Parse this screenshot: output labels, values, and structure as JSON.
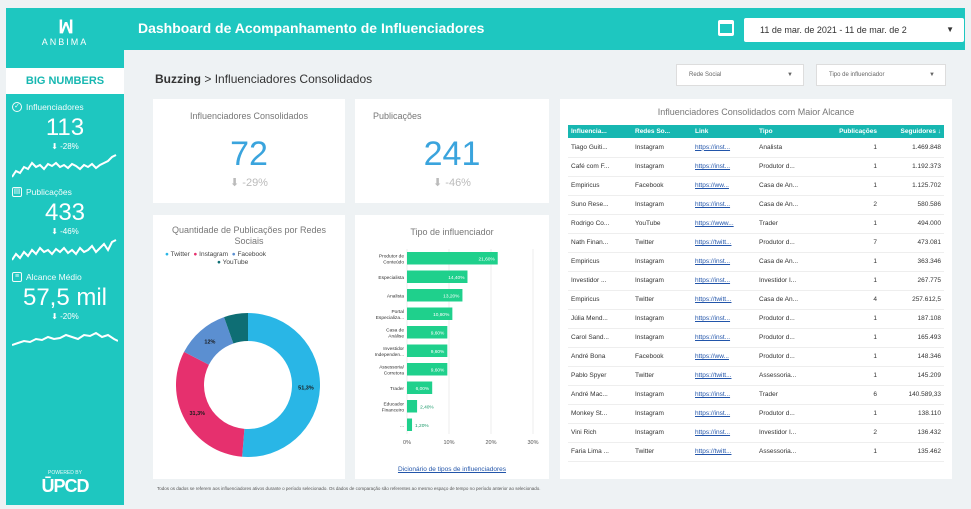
{
  "logo": {
    "mark": "ꟽ",
    "name": "ANBIMA"
  },
  "sidebar": {
    "section_title": "BIG NUMBERS",
    "metrics": [
      {
        "label": "Influenciadores",
        "value": "113",
        "delta": "⬇ -28%"
      },
      {
        "label": "Publicações",
        "value": "433",
        "delta": "⬇ -46%"
      },
      {
        "label": "Alcance Médio",
        "value": "57,5 mil",
        "delta": "⬇ -20%"
      }
    ],
    "powered_label": "POWERED BY",
    "powered_brand": "ŪPCD"
  },
  "header": {
    "title": "Dashboard de Acompanhamento de Influenciadores",
    "date_range": "11 de mar. de 2021 - 11 de mar. de 2"
  },
  "breadcrumb": {
    "section": "Buzzing",
    "separator": " > ",
    "page": "Influenciadores Consolidados"
  },
  "filters": [
    {
      "label": "Rede Social"
    },
    {
      "label": "Tipo de influenciador"
    }
  ],
  "kpis": [
    {
      "title": "Influenciadores Consolidados",
      "value": "72",
      "delta": "⬇ -29%"
    },
    {
      "title": "Publicações",
      "value": "241",
      "delta": "⬇ -46%"
    }
  ],
  "table": {
    "title": "Influenciadores Consolidados com Maior Alcance",
    "columns": [
      "Influencia...",
      "Redes So...",
      "Link",
      "Tipo",
      "Publicações",
      "Seguidores ↓"
    ],
    "rows": [
      [
        "Tiago Guiti...",
        "Instagram",
        "https://inst...",
        "Analista",
        "1",
        "1.469.848"
      ],
      [
        "Café com F...",
        "Instagram",
        "https://inst...",
        "Produtor d...",
        "1",
        "1.192.373"
      ],
      [
        "Empiricus",
        "Facebook",
        "https://ww...",
        "Casa de An...",
        "1",
        "1.125.702"
      ],
      [
        "Suno Rese...",
        "Instagram",
        "https://inst...",
        "Casa de An...",
        "2",
        "580.586"
      ],
      [
        "Rodrigo Co...",
        "YouTube",
        "https://www...",
        "Trader",
        "1",
        "494.000"
      ],
      [
        "Nath Finan...",
        "Twitter",
        "https://twitt...",
        "Produtor d...",
        "7",
        "473.081"
      ],
      [
        "Empiricus",
        "Instagram",
        "https://inst...",
        "Casa de An...",
        "1",
        "363.346"
      ],
      [
        "Investidor ...",
        "Instagram",
        "https://inst...",
        "Investidor I...",
        "1",
        "267.775"
      ],
      [
        "Empiricus",
        "Twitter",
        "https://twitt...",
        "Casa de An...",
        "4",
        "257.612,5"
      ],
      [
        "Júlia Mend...",
        "Instagram",
        "https://inst...",
        "Produtor d...",
        "1",
        "187.108"
      ],
      [
        "Carol Sand...",
        "Instagram",
        "https://inst...",
        "Produtor d...",
        "1",
        "165.493"
      ],
      [
        "André Bona",
        "Facebook",
        "https://ww...",
        "Produtor d...",
        "1",
        "148.346"
      ],
      [
        "Pablo Spyer",
        "Twitter",
        "https://twitt...",
        "Assessoria...",
        "1",
        "145.209"
      ],
      [
        "André Mac...",
        "Instagram",
        "https://inst...",
        "Trader",
        "6",
        "140.589,33"
      ],
      [
        "Monkey St...",
        "Instagram",
        "https://inst...",
        "Produtor d...",
        "1",
        "138.110"
      ],
      [
        "Vini Rich",
        "Instagram",
        "https://inst...",
        "Investidor I...",
        "2",
        "136.432"
      ],
      [
        "Faria Lima ...",
        "Twitter",
        "https://twitt...",
        "Assessoria...",
        "1",
        "135.462"
      ]
    ]
  },
  "donut": {
    "title": "Quantidade de Publicações por Redes Sociais",
    "legend": [
      {
        "name": "Twitter",
        "color": "#29b6e6"
      },
      {
        "name": "Instagram",
        "color": "#e6306e"
      },
      {
        "name": "Facebook",
        "color": "#5b8fd1"
      },
      {
        "name": "YouTube",
        "color": "#0e6e74"
      }
    ]
  },
  "bar": {
    "title": "Tipo de influenciador",
    "link": "Dicionário de tipos de influenciadores",
    "color": "#1fd08c"
  },
  "chart_data": [
    {
      "type": "pie",
      "title": "Quantidade de Publicações por Redes Sociais",
      "categories": [
        "Twitter",
        "Instagram",
        "Facebook",
        "YouTube"
      ],
      "values": [
        51.3,
        31.3,
        12.0,
        5.4
      ],
      "labels": [
        "51,3%",
        "31,3%",
        "12%",
        ""
      ]
    },
    {
      "type": "bar",
      "orientation": "horizontal",
      "title": "Tipo de influenciador",
      "categories": [
        "Produtor de Conteúdo",
        "Especialista",
        "Analista",
        "Portal Especializa...",
        "Casa de Análise",
        "Investidor Independen...",
        "Assessoria/ Corretora",
        "Trader",
        "Educador Financeiro",
        "..."
      ],
      "values": [
        21.6,
        14.4,
        13.2,
        10.8,
        9.6,
        9.6,
        9.6,
        6.0,
        2.4,
        1.2
      ],
      "labels": [
        "21,60%",
        "14,40%",
        "13,20%",
        "10,80%",
        "9,60%",
        "9,60%",
        "9,60%",
        "6,00%",
        "2,40%",
        "1,20%"
      ],
      "xticks": [
        "0%",
        "10%",
        "20%",
        "30%"
      ],
      "xlim": [
        0,
        30
      ]
    }
  ],
  "footer": "Todos os dados se referem aos influenciadores ativos durante o período selecionado. Os dados de comparação são referentes ao mesmo espaço de tempo no período anterior ao selecionado."
}
